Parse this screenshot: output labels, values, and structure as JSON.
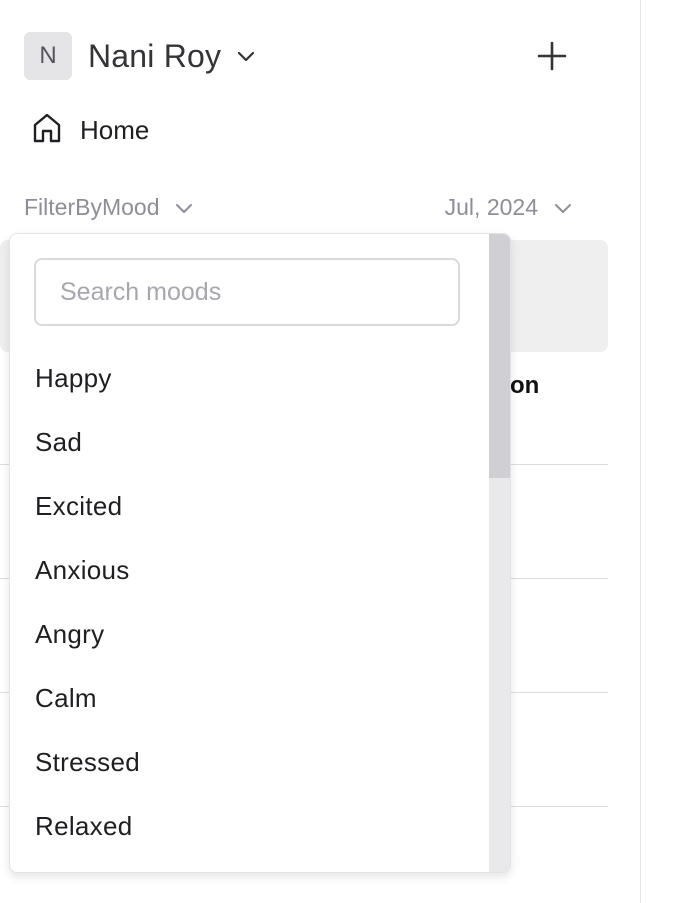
{
  "header": {
    "avatar_initial": "N",
    "user_name": "Nani Roy"
  },
  "nav": {
    "home_label": "Home"
  },
  "filters": {
    "mood_label": "FilterByMood",
    "date_label": "Jul, 2024"
  },
  "background": {
    "column_header_partial": "sion"
  },
  "mood_dropdown": {
    "search_placeholder": "Search moods",
    "search_value": "",
    "options": [
      "Happy",
      "Sad",
      "Excited",
      "Anxious",
      "Angry",
      "Calm",
      "Stressed",
      "Relaxed"
    ]
  },
  "icons": {
    "home": "home-icon",
    "add": "plus-icon",
    "chevron": "chevron-down-icon"
  },
  "colors": {
    "muted_text": "#8e8e98",
    "avatar_bg": "#e5e5e8",
    "card_bg": "#efefef",
    "scroll_thumb": "#cfcfd4"
  }
}
